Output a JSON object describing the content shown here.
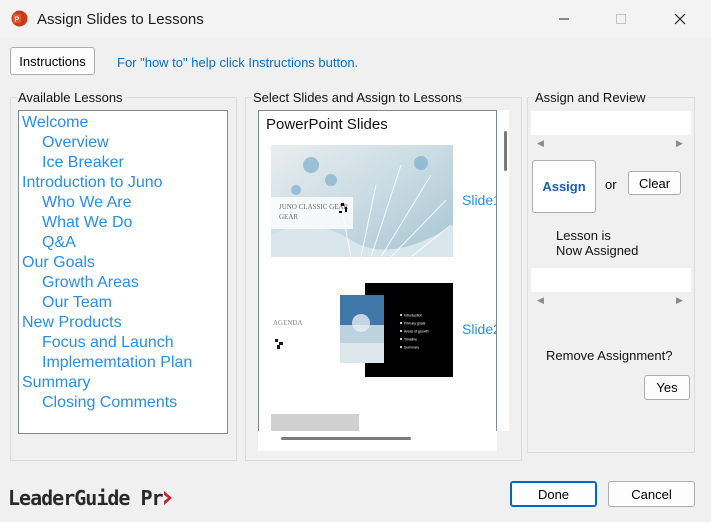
{
  "window": {
    "title": "Assign Slides to Lessons",
    "app_icon": "powerpoint-icon",
    "accent": "#c43e1c"
  },
  "toolbar": {
    "instructions_label": "Instructions",
    "hint_text": "For \"how to\" help click Instructions button."
  },
  "lessons": {
    "group_label": "Available Lessons",
    "items": [
      {
        "label": "Welcome",
        "level": 0
      },
      {
        "label": "Overview",
        "level": 1
      },
      {
        "label": "Ice Breaker",
        "level": 1
      },
      {
        "label": "Introduction to Juno",
        "level": 0
      },
      {
        "label": "Who We Are",
        "level": 1
      },
      {
        "label": "What We Do",
        "level": 1
      },
      {
        "label": "Q&A",
        "level": 1
      },
      {
        "label": "Our Goals",
        "level": 0
      },
      {
        "label": "Growth Areas",
        "level": 1
      },
      {
        "label": "Our Team",
        "level": 1
      },
      {
        "label": "New Products",
        "level": 0
      },
      {
        "label": "Focus and Launch",
        "level": 1
      },
      {
        "label": "Implememtation Plan",
        "level": 1
      },
      {
        "label": "Summary",
        "level": 0
      },
      {
        "label": "Closing Comments",
        "level": 1
      }
    ]
  },
  "slides": {
    "group_label": "Select Slides and Assign to Lessons",
    "list_title": "PowerPoint Slides",
    "items": [
      {
        "link": "Slide1",
        "thumb_text": "JUNO CLASSIC GEAR"
      },
      {
        "link": "Slide2",
        "thumb_text": "AGENDA",
        "bullets": [
          "Introduction",
          "Primary goals",
          "Areas of growth",
          "Timeline",
          "Summary"
        ]
      }
    ]
  },
  "assign": {
    "group_label": "Assign and Review",
    "assign_label": "Assign",
    "or_text": "or",
    "clear_label": "Clear",
    "status_line1": "Lesson is",
    "status_line2": "Now Assigned",
    "remove_question": "Remove Assignment?",
    "yes_label": "Yes"
  },
  "footer": {
    "brand_text": "LeaderGuide Pr",
    "done_label": "Done",
    "cancel_label": "Cancel",
    "brand_accent": "#c0282d"
  }
}
